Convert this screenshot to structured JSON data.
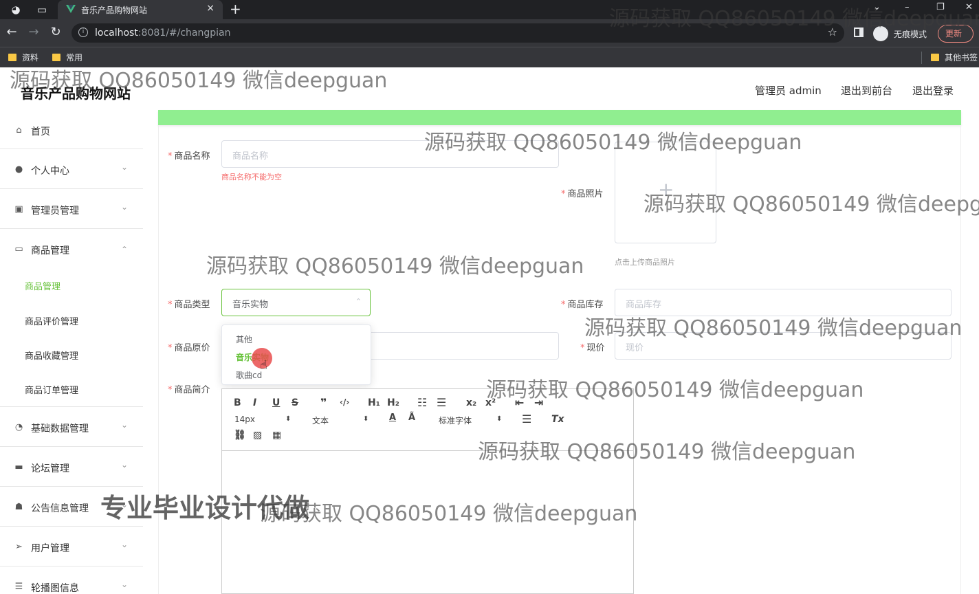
{
  "browser": {
    "tab_title": "音乐产品购物网站",
    "tab_close": "×",
    "new_tab": "+",
    "url_host": "localhost",
    "url_rest": ":8081/#/changpian",
    "incognito_label": "无痕模式",
    "update_label": "更新",
    "bookmarks": [
      "资料",
      "常用",
      "其他书签"
    ],
    "window_controls": [
      "⌄",
      "–",
      "❐",
      "✕"
    ]
  },
  "header": {
    "title": "音乐产品购物网站",
    "user": "管理员 admin",
    "to_front": "退出到前台",
    "logout": "退出登录"
  },
  "sidebar": {
    "items": [
      {
        "label": "首页",
        "icon": "home-icon"
      },
      {
        "label": "个人中心",
        "icon": "user-icon"
      },
      {
        "label": "管理员管理",
        "icon": "clipboard-icon"
      },
      {
        "label": "商品管理",
        "icon": "chat-icon"
      },
      {
        "label": "基础数据管理",
        "icon": "gauge-icon"
      },
      {
        "label": "论坛管理",
        "icon": "briefcase-icon"
      },
      {
        "label": "公告信息管理",
        "icon": "thumb-icon"
      },
      {
        "label": "用户管理",
        "icon": "send-icon"
      },
      {
        "label": "轮播图信息",
        "icon": "list-icon"
      }
    ],
    "submenu": [
      "商品管理",
      "商品评价管理",
      "商品收藏管理",
      "商品订单管理"
    ]
  },
  "form": {
    "name_label": "商品名称",
    "name_placeholder": "商品名称",
    "name_error": "商品名称不能为空",
    "photo_label": "商品照片",
    "photo_hint": "点击上传商品照片",
    "type_label": "商品类型",
    "type_value": "音乐实物",
    "type_options": [
      "其他",
      "音乐实物",
      "歌曲cd"
    ],
    "stock_label": "商品库存",
    "stock_placeholder": "商品库存",
    "orig_price_label": "商品原价",
    "price_label": "现价",
    "price_placeholder": "现价",
    "intro_label": "商品简介"
  },
  "editor": {
    "font_size": "14px",
    "text_type": "文本",
    "font_family": "标准字体"
  },
  "watermarks": {
    "text": "源码获取 QQ86050149 微信deepguan",
    "text_cut_1": "源码获取 QQ86050149 微信deepgu",
    "text_cut_2": "源码获取 QQ86050149 微信deepguan",
    "banner": "专业毕业设计代做"
  }
}
